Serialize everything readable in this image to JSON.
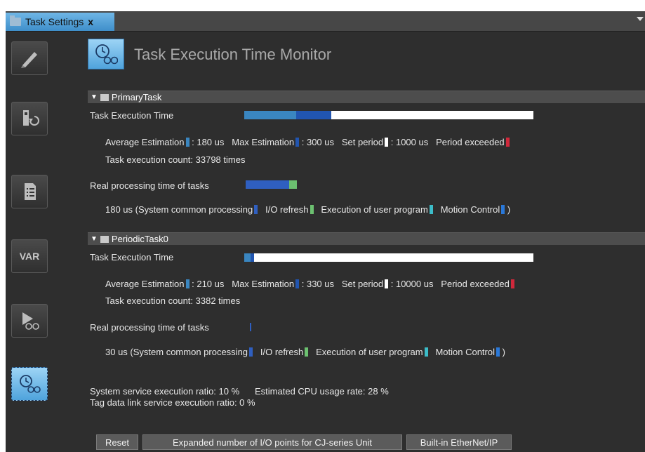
{
  "tab": {
    "label": "Task Settings",
    "close": "x"
  },
  "page": {
    "title": "Task Execution Time Monitor"
  },
  "rail": {
    "var_label": "VAR"
  },
  "sections": [
    {
      "name": "PrimaryTask",
      "exec_time_label": "Task Execution Time",
      "avg_label": "Average Estimation",
      "avg_value": ": 180 us",
      "max_label": "Max Estimation",
      "max_value": ": 300 us",
      "period_label": "Set period",
      "period_value": ": 1000 us",
      "exceeded_label": "Period exceeded",
      "count_text": "Task execution count: 33798 times",
      "real_label": "Real processing time of tasks",
      "breakdown_prefix": "180 us (System common processing",
      "io_label": "I/O refresh",
      "user_label": "Execution of user program",
      "motion_label": "Motion Control",
      "close_paren": ")",
      "avg_us": 180,
      "max_us": 300,
      "period_us": 1000
    },
    {
      "name": "PeriodicTask0",
      "exec_time_label": "Task Execution Time",
      "avg_label": "Average Estimation",
      "avg_value": ": 210 us",
      "max_label": "Max Estimation",
      "max_value": ": 330 us",
      "period_label": "Set period",
      "period_value": ": 10000 us",
      "exceeded_label": "Period exceeded",
      "count_text": "Task execution count: 3382 times",
      "real_label": "Real processing time of tasks",
      "breakdown_prefix": "30 us (System common processing",
      "io_label": "I/O refresh",
      "user_label": "Execution of user program",
      "motion_label": "Motion Control",
      "close_paren": ")",
      "avg_us": 210,
      "max_us": 330,
      "period_us": 10000
    }
  ],
  "footer": {
    "system_ratio": "System service execution ratio: 10 %",
    "cpu_usage": "Estimated CPU usage rate: 28 %",
    "tag_ratio": "Tag data link service execution ratio: 0 %"
  },
  "buttons": {
    "reset": "Reset",
    "expanded": "Expanded number of I/O points for CJ-series Unit",
    "ethernet": "Built-in EtherNet/IP"
  },
  "colors": {
    "avg": "#3a86c0",
    "max": "#2155b0",
    "period": "#ffffff",
    "exceeded": "#d0283b",
    "system": "#2f5fc0",
    "io": "#6cc070",
    "user": "#3cbcc8",
    "motion": "#2a78d8"
  }
}
